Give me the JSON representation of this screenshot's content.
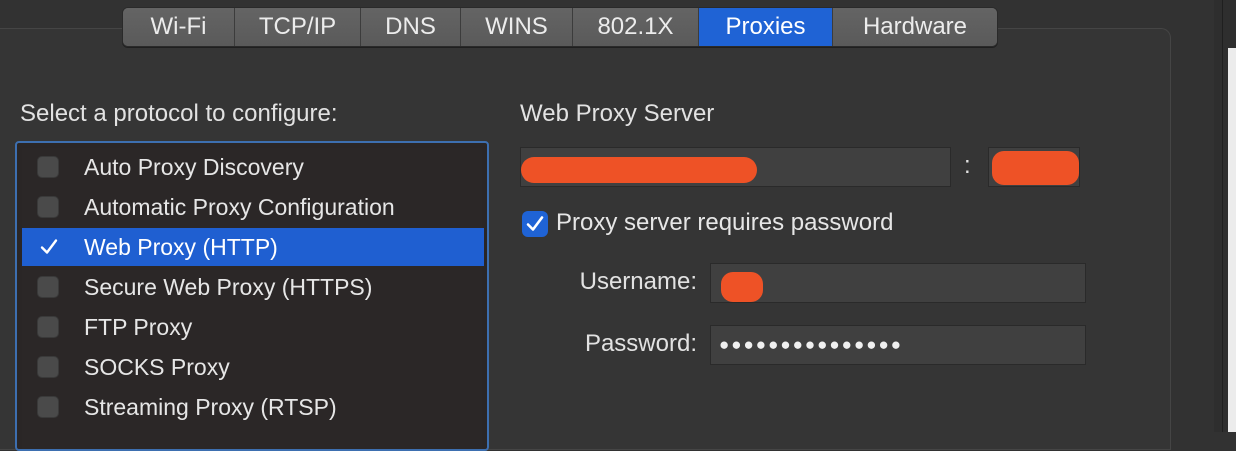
{
  "tabs": [
    {
      "label": "Wi-Fi",
      "active": false
    },
    {
      "label": "TCP/IP",
      "active": false
    },
    {
      "label": "DNS",
      "active": false
    },
    {
      "label": "WINS",
      "active": false
    },
    {
      "label": "802.1X",
      "active": false
    },
    {
      "label": "Proxies",
      "active": true
    },
    {
      "label": "Hardware",
      "active": false
    }
  ],
  "protocols": {
    "heading": "Select a protocol to configure:",
    "items": [
      {
        "label": "Auto Proxy Discovery",
        "checked": false,
        "selected": false
      },
      {
        "label": "Automatic Proxy Configuration",
        "checked": false,
        "selected": false
      },
      {
        "label": "Web Proxy (HTTP)",
        "checked": true,
        "selected": true
      },
      {
        "label": "Secure Web Proxy (HTTPS)",
        "checked": false,
        "selected": false
      },
      {
        "label": "FTP Proxy",
        "checked": false,
        "selected": false
      },
      {
        "label": "SOCKS Proxy",
        "checked": false,
        "selected": false
      },
      {
        "label": "Streaming Proxy (RTSP)",
        "checked": false,
        "selected": false
      }
    ]
  },
  "proxy": {
    "heading": "Web Proxy Server",
    "separator": ":",
    "requires_password_label": "Proxy server requires password",
    "requires_password": true,
    "username_label": "Username:",
    "password_label": "Password:",
    "password_mask": "●●●●●●●●●●●●●●●"
  },
  "colors": {
    "accent": "#1f63d5",
    "redaction": "#ee5226",
    "background": "#323232"
  }
}
